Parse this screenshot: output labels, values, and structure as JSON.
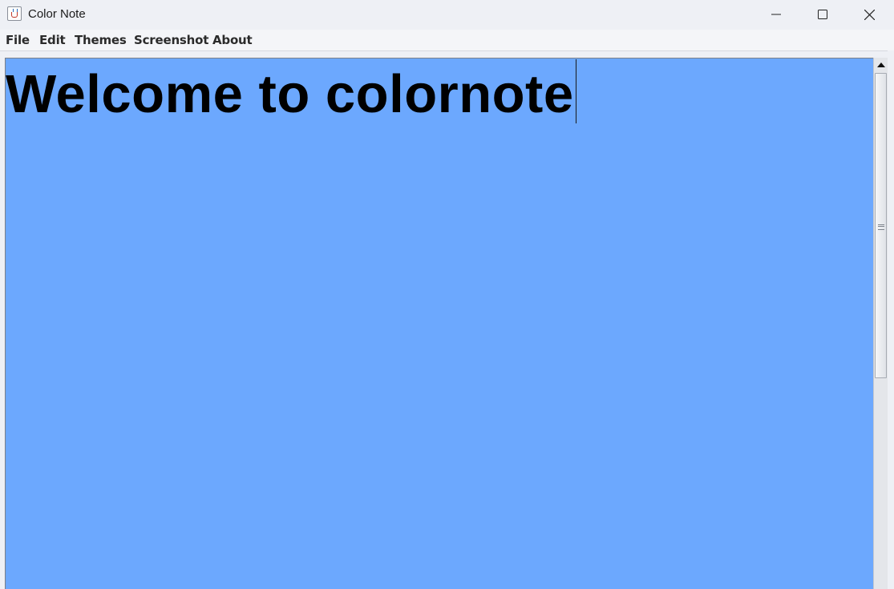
{
  "window": {
    "title": "Color Note",
    "controls": [
      "minimize-icon",
      "maximize-icon",
      "close-icon"
    ]
  },
  "menu": {
    "file": "File",
    "edit": "Edit",
    "themes": "Themes",
    "screenshot": "Screenshot",
    "about": "About"
  },
  "editor": {
    "text": "Welcome to colornote",
    "background_color": "#6ca8fe",
    "text_color": "#000000"
  },
  "scrollbar": {
    "icons": [
      "scroll-up-arrow-icon",
      "scroll-grip-icon"
    ]
  }
}
